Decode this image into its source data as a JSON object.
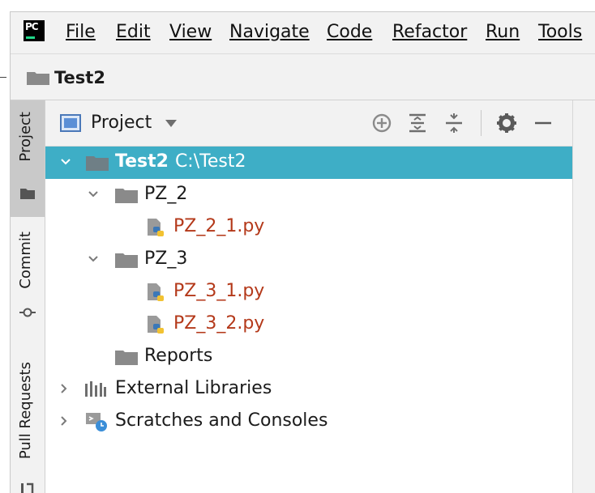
{
  "app": {
    "logo_text": "PC"
  },
  "menu": {
    "items": [
      "File",
      "Edit",
      "View",
      "Navigate",
      "Code",
      "Refactor",
      "Run",
      "Tools"
    ]
  },
  "navbar": {
    "project_name": "Test2"
  },
  "tool_strip": {
    "tabs": [
      "Project",
      "Commit",
      "Pull Requests"
    ]
  },
  "panel": {
    "title": "Project"
  },
  "tree": [
    {
      "label": "Test2",
      "path": "C:\\Test2",
      "type": "folder",
      "expanded": true,
      "selected": true
    },
    {
      "label": "PZ_2",
      "type": "folder",
      "expanded": true
    },
    {
      "label": "PZ_2_1.py",
      "type": "python-file"
    },
    {
      "label": "PZ_3",
      "type": "folder",
      "expanded": true
    },
    {
      "label": "PZ_3_1.py",
      "type": "python-file"
    },
    {
      "label": "PZ_3_2.py",
      "type": "python-file"
    },
    {
      "label": "Reports",
      "type": "folder"
    },
    {
      "label": "External Libraries",
      "type": "libraries",
      "expanded": false
    },
    {
      "label": "Scratches and Consoles",
      "type": "scratches",
      "expanded": false
    }
  ],
  "colors": {
    "selection": "#3eaec6",
    "python_file": "#b4391a",
    "folder": "#8a8a8a",
    "panel_bg": "#f2f2f2"
  }
}
